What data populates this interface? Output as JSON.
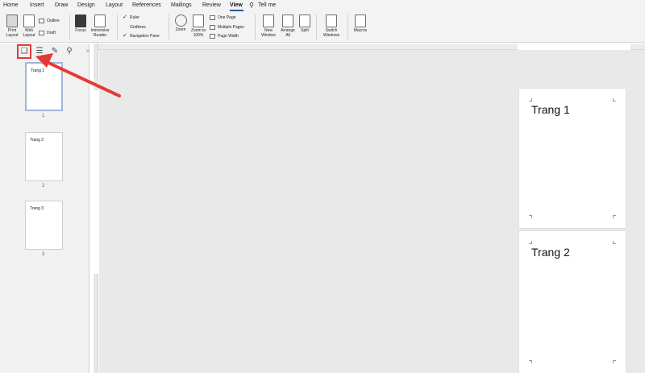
{
  "tabs": [
    "Home",
    "Insert",
    "Draw",
    "Design",
    "Layout",
    "References",
    "Mailings",
    "Review",
    "View",
    "Tell me"
  ],
  "active_tab": "View",
  "ribbon": {
    "print_layout": "Print Layout",
    "web_layout": "Web Layout",
    "outline": "Outline",
    "draft": "Draft",
    "focus": "Focus",
    "immersive_reader": "Immersive Reader",
    "ruler": "Ruler",
    "gridlines": "Gridlines",
    "navigation_pane": "Navigation Pane",
    "zoom": "Zoom",
    "zoom_100": "Zoom to 100%",
    "one_page": "One Page",
    "multiple_pages": "Multiple Pages",
    "page_width": "Page Width",
    "new_window": "New Window",
    "arrange_all": "Arrange All",
    "split": "Split",
    "switch_windows": "Switch Windows",
    "macros": "Macros"
  },
  "nav": {
    "thumbnails": [
      {
        "text": "Trang 1",
        "num": "1"
      },
      {
        "text": "Trang 2",
        "num": "2"
      },
      {
        "text": "Trang 3",
        "num": "3"
      }
    ]
  },
  "pages": [
    {
      "text": "Trang 1"
    },
    {
      "text": "Trang 2"
    }
  ],
  "colors": {
    "annotation": "#e53935",
    "accent": "#2b579a"
  }
}
